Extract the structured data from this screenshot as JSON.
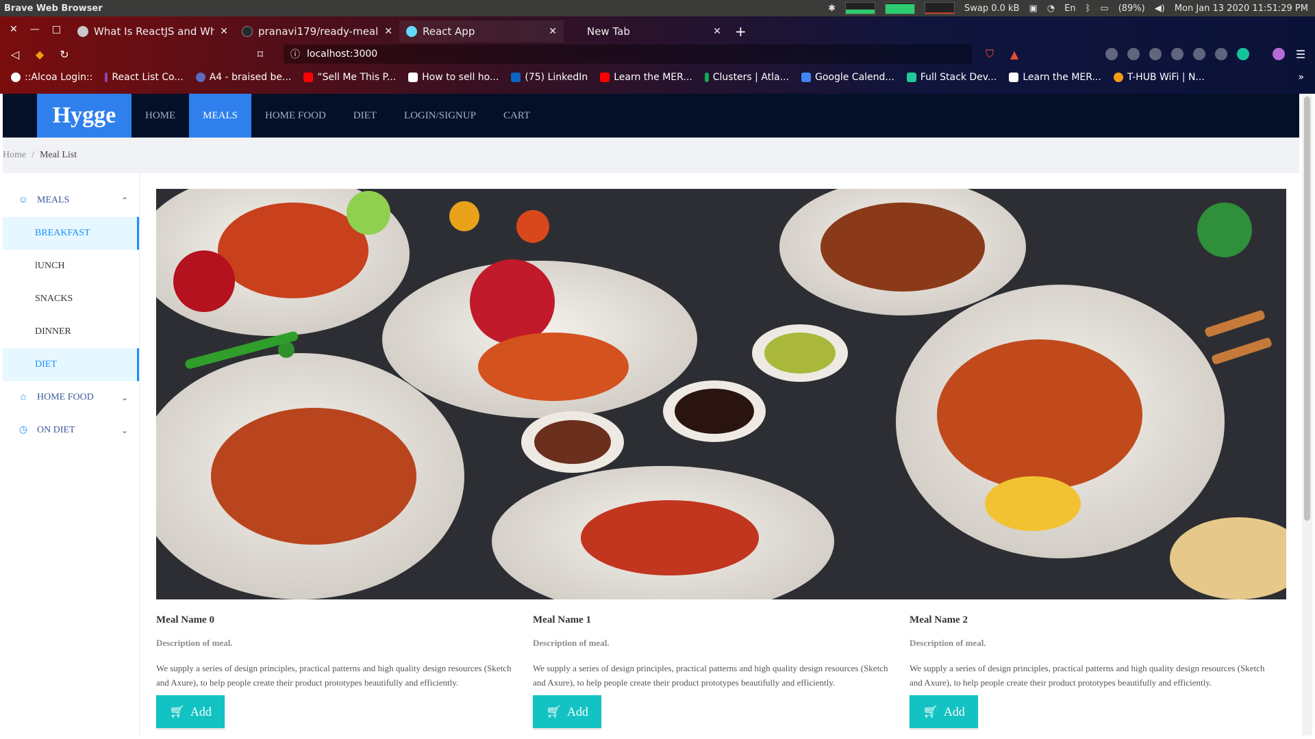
{
  "os": {
    "app_name": "Brave Web Browser",
    "swap": "Swap 0.0 kB",
    "battery": "(89%)",
    "keyboard": "En",
    "datetime": "Mon Jan 13 2020 11:51:29 PM"
  },
  "browser": {
    "tabs": [
      {
        "title": "What Is ReactJS and Why S",
        "favicon_color": "#c9c9c9"
      },
      {
        "title": "pranavi179/ready-meal",
        "favicon_color": "#24292e"
      },
      {
        "title": "React App",
        "favicon_color": "#61dafb"
      },
      {
        "title": "New Tab",
        "favicon_color": "#aaaaaa"
      }
    ],
    "url": "localhost:3000",
    "bookmarks": [
      {
        "label": "::Alcoa Login::",
        "color": "#ffffff"
      },
      {
        "label": "React List Co...",
        "color": "#8e44ad"
      },
      {
        "label": "A4 - braised be...",
        "color": "#5c6bc0"
      },
      {
        "label": "“Sell Me This P...",
        "color": "#ff0000"
      },
      {
        "label": "How to sell ho...",
        "color": "#ffffff"
      },
      {
        "label": "(75) LinkedIn",
        "color": "#0a66c2"
      },
      {
        "label": "Learn the MER...",
        "color": "#ff0000"
      },
      {
        "label": "Clusters | Atla...",
        "color": "#13aa52"
      },
      {
        "label": "Google Calend...",
        "color": "#4285f4"
      },
      {
        "label": "Full Stack Dev...",
        "color": "#20c997"
      },
      {
        "label": "Learn the MER...",
        "color": "#ffffff"
      },
      {
        "label": "T-HUB WiFi | N...",
        "color": "#f39c12"
      }
    ]
  },
  "site": {
    "logo": "Hygge",
    "nav": [
      "HOME",
      "MEALS",
      "HOME FOOD",
      "DIET",
      "LOGIN/SIGNUP",
      "CART"
    ],
    "breadcrumb": {
      "home": "Home",
      "separator": "/",
      "current": "Meal List"
    }
  },
  "sidebar": {
    "groups": [
      {
        "label": "MEALS",
        "icon": "smile-icon",
        "expanded": true,
        "items": [
          "BREAKFAST",
          "lUNCH",
          "SNACKS",
          "DINNER",
          "DIET"
        ]
      },
      {
        "label": "HOME FOOD",
        "icon": "home-icon",
        "expanded": false
      },
      {
        "label": "ON DIET",
        "icon": "clock-icon",
        "expanded": false
      }
    ]
  },
  "meals": [
    {
      "name": "Meal Name 0",
      "desc": "Description of meal.",
      "body": "We supply a series of design principles, practical patterns and high quality design resources (Sketch and Axure), to help people create their product prototypes beautifully and efficiently.",
      "button": "Add"
    },
    {
      "name": "Meal Name 1",
      "desc": "Description of meal.",
      "body": "We supply a series of design principles, practical patterns and high quality design resources (Sketch and Axure), to help people create their product prototypes beautifully and efficiently.",
      "button": "Add"
    },
    {
      "name": "Meal Name 2",
      "desc": "Description of meal.",
      "body": "We supply a series of design principles, practical patterns and high quality design resources (Sketch and Axure), to help people create their product prototypes beautifully and efficiently.",
      "button": "Add"
    }
  ],
  "colors": {
    "primary": "#2f80ed",
    "nav_bg": "#031028",
    "add_button": "#13c2c2",
    "menu_highlight": "#e6f7ff"
  }
}
